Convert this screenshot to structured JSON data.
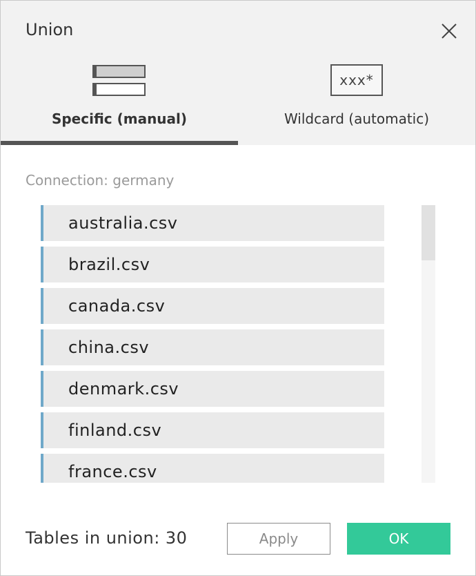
{
  "dialog": {
    "title": "Union",
    "close_icon": "close-icon"
  },
  "tabs": [
    {
      "label": "Specific (manual)",
      "icon": "manual-tables-icon",
      "active": true
    },
    {
      "label": "Wildcard (automatic)",
      "icon": "wildcard-icon",
      "icon_text": "xxx*",
      "active": false
    }
  ],
  "connection_label": "Connection: germany",
  "tables": [
    {
      "name": "australia.csv"
    },
    {
      "name": "brazil.csv"
    },
    {
      "name": "canada.csv"
    },
    {
      "name": "china.csv"
    },
    {
      "name": "denmark.csv"
    },
    {
      "name": "finland.csv"
    },
    {
      "name": "france.csv"
    }
  ],
  "footer": {
    "count_label": "Tables in union: 30",
    "apply_label": "Apply",
    "ok_label": "OK"
  },
  "colors": {
    "header_bg": "#f2f2f2",
    "tab_underline": "#555555",
    "item_accent": "#6fa8c9",
    "ok_button": "#33c999"
  }
}
